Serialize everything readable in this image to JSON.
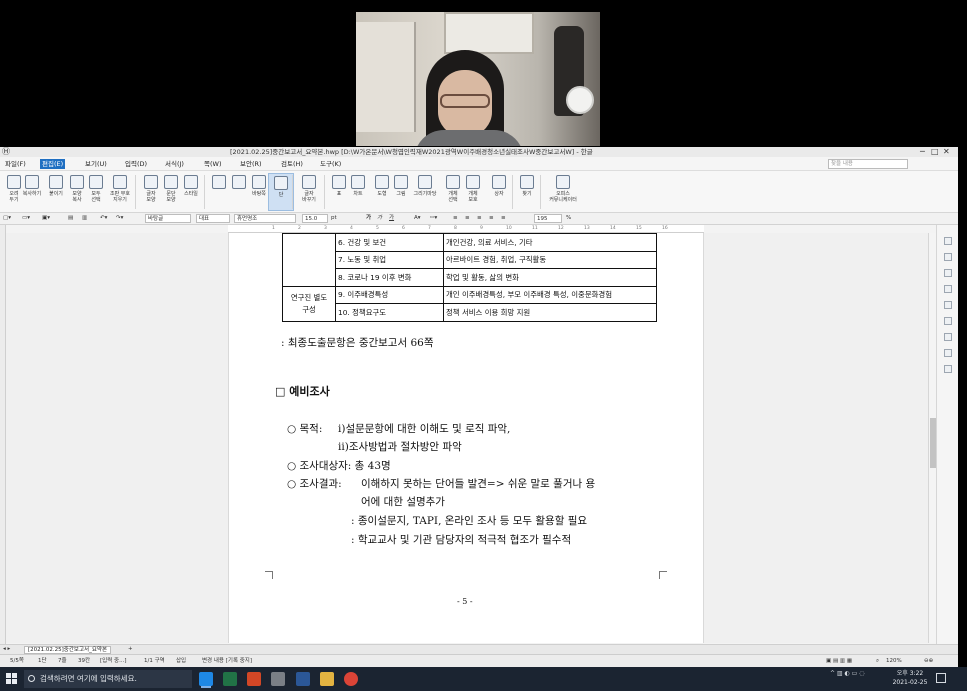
{
  "window": {
    "title": "[2021.02.25]중간보고서_요약본.hwp [D:\\W가온문서\\W청엽인력재W2021광역W이주배경청소년실태조사W중간보고서W] - 한글",
    "controls": [
      "─",
      "□",
      "✕"
    ]
  },
  "menubar": {
    "items": [
      "파일(F)",
      "편집(E)",
      "보기(U)",
      "입력(D)",
      "서식(J)",
      "쪽(W)",
      "보안(R)",
      "검토(H)",
      "도구(K)"
    ],
    "active_index": 1,
    "search_placeholder": "찾을 내용"
  },
  "ribbon": {
    "buttons": [
      "오려\n두기",
      "복사하기",
      "붙이기",
      "모양\n복사",
      "모두\n선택",
      "조판 부호\n지우기",
      "글자\n모양",
      "문단\n모양",
      "스타일",
      "",
      "",
      "바탕쪽",
      "단",
      "글자\n바꾸기",
      "표",
      "차트",
      "도형",
      "그림",
      "그리기마당",
      "개체\n선택",
      "개체\n보호",
      "상자",
      "찾기",
      "오피스\n커뮤니케이터"
    ]
  },
  "formatbar": {
    "style": "바탕글",
    "language": "대표",
    "font": "휴먼명조",
    "size": "15.0",
    "unit": "pt",
    "zoom": "195",
    "bold": "가",
    "italic": "가",
    "underline": "가"
  },
  "ruler": {
    "ticks": [
      "1",
      "2",
      "3",
      "4",
      "5",
      "6",
      "7",
      "8",
      "9",
      "10",
      "11",
      "12",
      "13",
      "14",
      "15",
      "16"
    ]
  },
  "table": {
    "rows": [
      {
        "group": "",
        "item": "6. 건강 및 보건",
        "detail": "개인건강, 의료 서비스, 기타"
      },
      {
        "group": "",
        "item": "7. 노동 및 취업",
        "detail": "아르바이트 경험, 취업, 구직활동"
      },
      {
        "group": "",
        "item": "8. 코로나 19 이후  변화",
        "detail": "학업 및 활동, 삶의 변화"
      },
      {
        "group": "연구진 별도\n구성",
        "item": "9. 이주배경특성",
        "detail": "개인 이주배경특성, 부모 이주배경 특성, 이중문화경험"
      },
      {
        "group": "",
        "item": "10. 정책요구도",
        "detail": "정책 서비스 이용 희망 지원"
      }
    ]
  },
  "doc": {
    "note": ": 최종도출문항은 중간보고서 66쪽",
    "section_title": "□  예비조사",
    "purpose_label": "○  목적:",
    "purpose_1": "i)설문문항에 대한 이해도 및 로직 파악,",
    "purpose_2": "ii)조사방법과 절차방안 파악",
    "target": "○  조사대상자: 총 43명",
    "result_label": "○  조사결과:",
    "result_1a": "이해하지 못하는 단어들 발견=> 쉬운 말로 풀거나 용",
    "result_1b": "어에 대한 설명추가",
    "result_2": ": 종이설문지, TAPI, 온라인 조사 등 모두 활용할 필요",
    "result_3": ": 학교교사 및 기관 담당자의 적극적 협조가 필수적",
    "page_number": "- 5 -"
  },
  "tabbar": {
    "tab_label": "[2021.02.25]중간보고서_요약본",
    "add_label": "+"
  },
  "statusbar": {
    "page": "5/5쪽",
    "section": "1단",
    "line": "7줄",
    "column": "39칸",
    "mode": "[입력 중...]",
    "section_count": "1/1 구역",
    "insert": "삽입",
    "track": "변경 내용 [기록 중지]",
    "zoom": "120%"
  },
  "taskbar": {
    "search_placeholder": "검색하려면 여기에 입력하세요.",
    "time": "오후 3:22",
    "date": "2021-02-25",
    "colors": {
      "word": "#2b5797",
      "excel": "#217346",
      "ppt": "#d24726",
      "hwp": "#1e88e5",
      "chrome": "#db4437"
    }
  }
}
